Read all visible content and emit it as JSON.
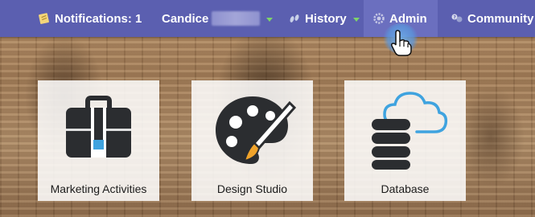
{
  "navbar": {
    "notifications_label": "Notifications: 1",
    "user_name": "Candice",
    "history_label": "History",
    "admin_label": "Admin",
    "community_label": "Community"
  },
  "tiles": [
    {
      "label": "Marketing Activities",
      "icon": "briefcase-icon"
    },
    {
      "label": "Design Studio",
      "icon": "palette-icon"
    },
    {
      "label": "Database",
      "icon": "database-cloud-icon"
    }
  ],
  "colors": {
    "navbar": "#5b5fb0",
    "admin_highlight": "#6b6fbf",
    "accent_blue": "#3fa3df",
    "accent_orange": "#f0a32a",
    "caret_green": "#7ed36a"
  }
}
